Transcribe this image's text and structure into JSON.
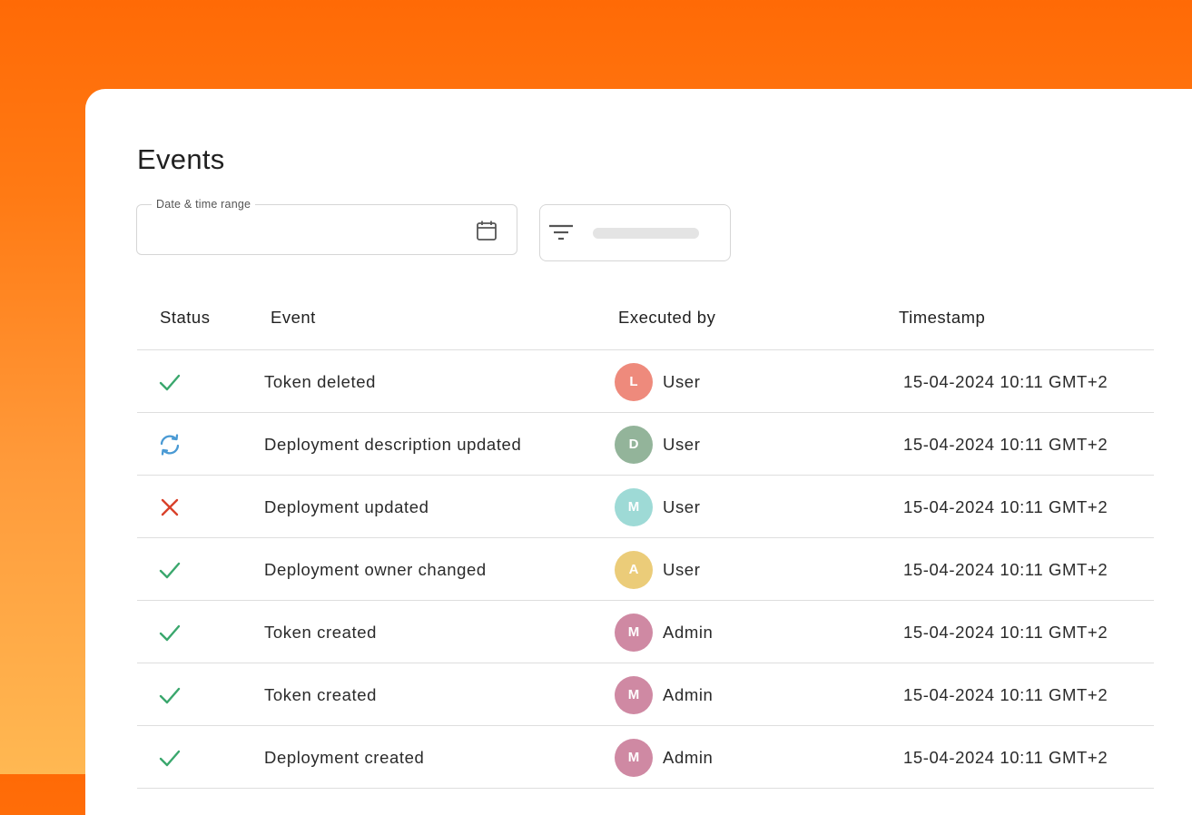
{
  "page": {
    "title": "Events"
  },
  "filters": {
    "date_label": "Date & time range",
    "date_value": "",
    "calendar_icon": "calendar-icon",
    "filter_icon": "filter-icon"
  },
  "table": {
    "headers": {
      "status": "Status",
      "event": "Event",
      "executed_by": "Executed by",
      "timestamp": "Timestamp"
    },
    "rows": [
      {
        "status": "success",
        "event": "Token deleted",
        "avatar": "L",
        "avatar_color": "#ee8a7c",
        "user": "User",
        "timestamp": "15-04-2024 10:11 GMT+2"
      },
      {
        "status": "in-progress",
        "event": "Deployment description updated",
        "avatar": "D",
        "avatar_color": "#93b49a",
        "user": "User",
        "timestamp": "15-04-2024 10:11 GMT+2"
      },
      {
        "status": "failed",
        "event": "Deployment updated",
        "avatar": "M",
        "avatar_color": "#9edad6",
        "user": "User",
        "timestamp": "15-04-2024 10:11 GMT+2"
      },
      {
        "status": "success",
        "event": "Deployment owner changed",
        "avatar": "A",
        "avatar_color": "#ebcc79",
        "user": "User",
        "timestamp": "15-04-2024 10:11 GMT+2"
      },
      {
        "status": "success",
        "event": "Token created",
        "avatar": "M",
        "avatar_color": "#cf89a3",
        "user": "Admin",
        "timestamp": "15-04-2024 10:11 GMT+2"
      },
      {
        "status": "success",
        "event": "Token created",
        "avatar": "M",
        "avatar_color": "#cf89a3",
        "user": "Admin",
        "timestamp": "15-04-2024 10:11 GMT+2"
      },
      {
        "status": "success",
        "event": "Deployment created",
        "avatar": "M",
        "avatar_color": "#cf89a3",
        "user": "Admin",
        "timestamp": "15-04-2024 10:11 GMT+2"
      }
    ]
  },
  "colors": {
    "success": "#3aa76d",
    "in_progress": "#4a9ad4",
    "failed": "#d9412b",
    "accent_orange": "#ff6a06"
  }
}
